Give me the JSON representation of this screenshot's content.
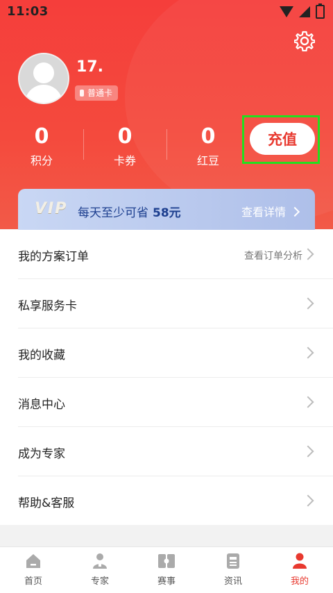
{
  "status": {
    "time": "11:03"
  },
  "profile": {
    "username": "17.",
    "card_badge": "普通卡"
  },
  "stats": [
    {
      "value": "0",
      "label": "积分"
    },
    {
      "value": "0",
      "label": "卡券"
    },
    {
      "value": "0",
      "label": "红豆"
    }
  ],
  "recharge_label": "充值",
  "vip": {
    "logo": "VIP",
    "text": "每天至少可省",
    "amount": "58元",
    "detail": "查看详情"
  },
  "menu": [
    {
      "title": "我的方案订单",
      "extra": "查看订单分析"
    },
    {
      "title": "私享服务卡",
      "extra": ""
    },
    {
      "title": "我的收藏",
      "extra": ""
    },
    {
      "title": "消息中心",
      "extra": ""
    },
    {
      "title": "成为专家",
      "extra": ""
    },
    {
      "title": "帮助&客服",
      "extra": ""
    }
  ],
  "tabs": [
    {
      "label": "首页",
      "icon": "home-icon"
    },
    {
      "label": "专家",
      "icon": "expert-icon"
    },
    {
      "label": "赛事",
      "icon": "match-icon"
    },
    {
      "label": "资讯",
      "icon": "news-icon"
    },
    {
      "label": "我的",
      "icon": "profile-icon"
    }
  ],
  "colors": {
    "accent": "#e8392f",
    "header": "#f53e3b",
    "vip_text": "#1d3f8f",
    "highlight": "#22e01f"
  }
}
